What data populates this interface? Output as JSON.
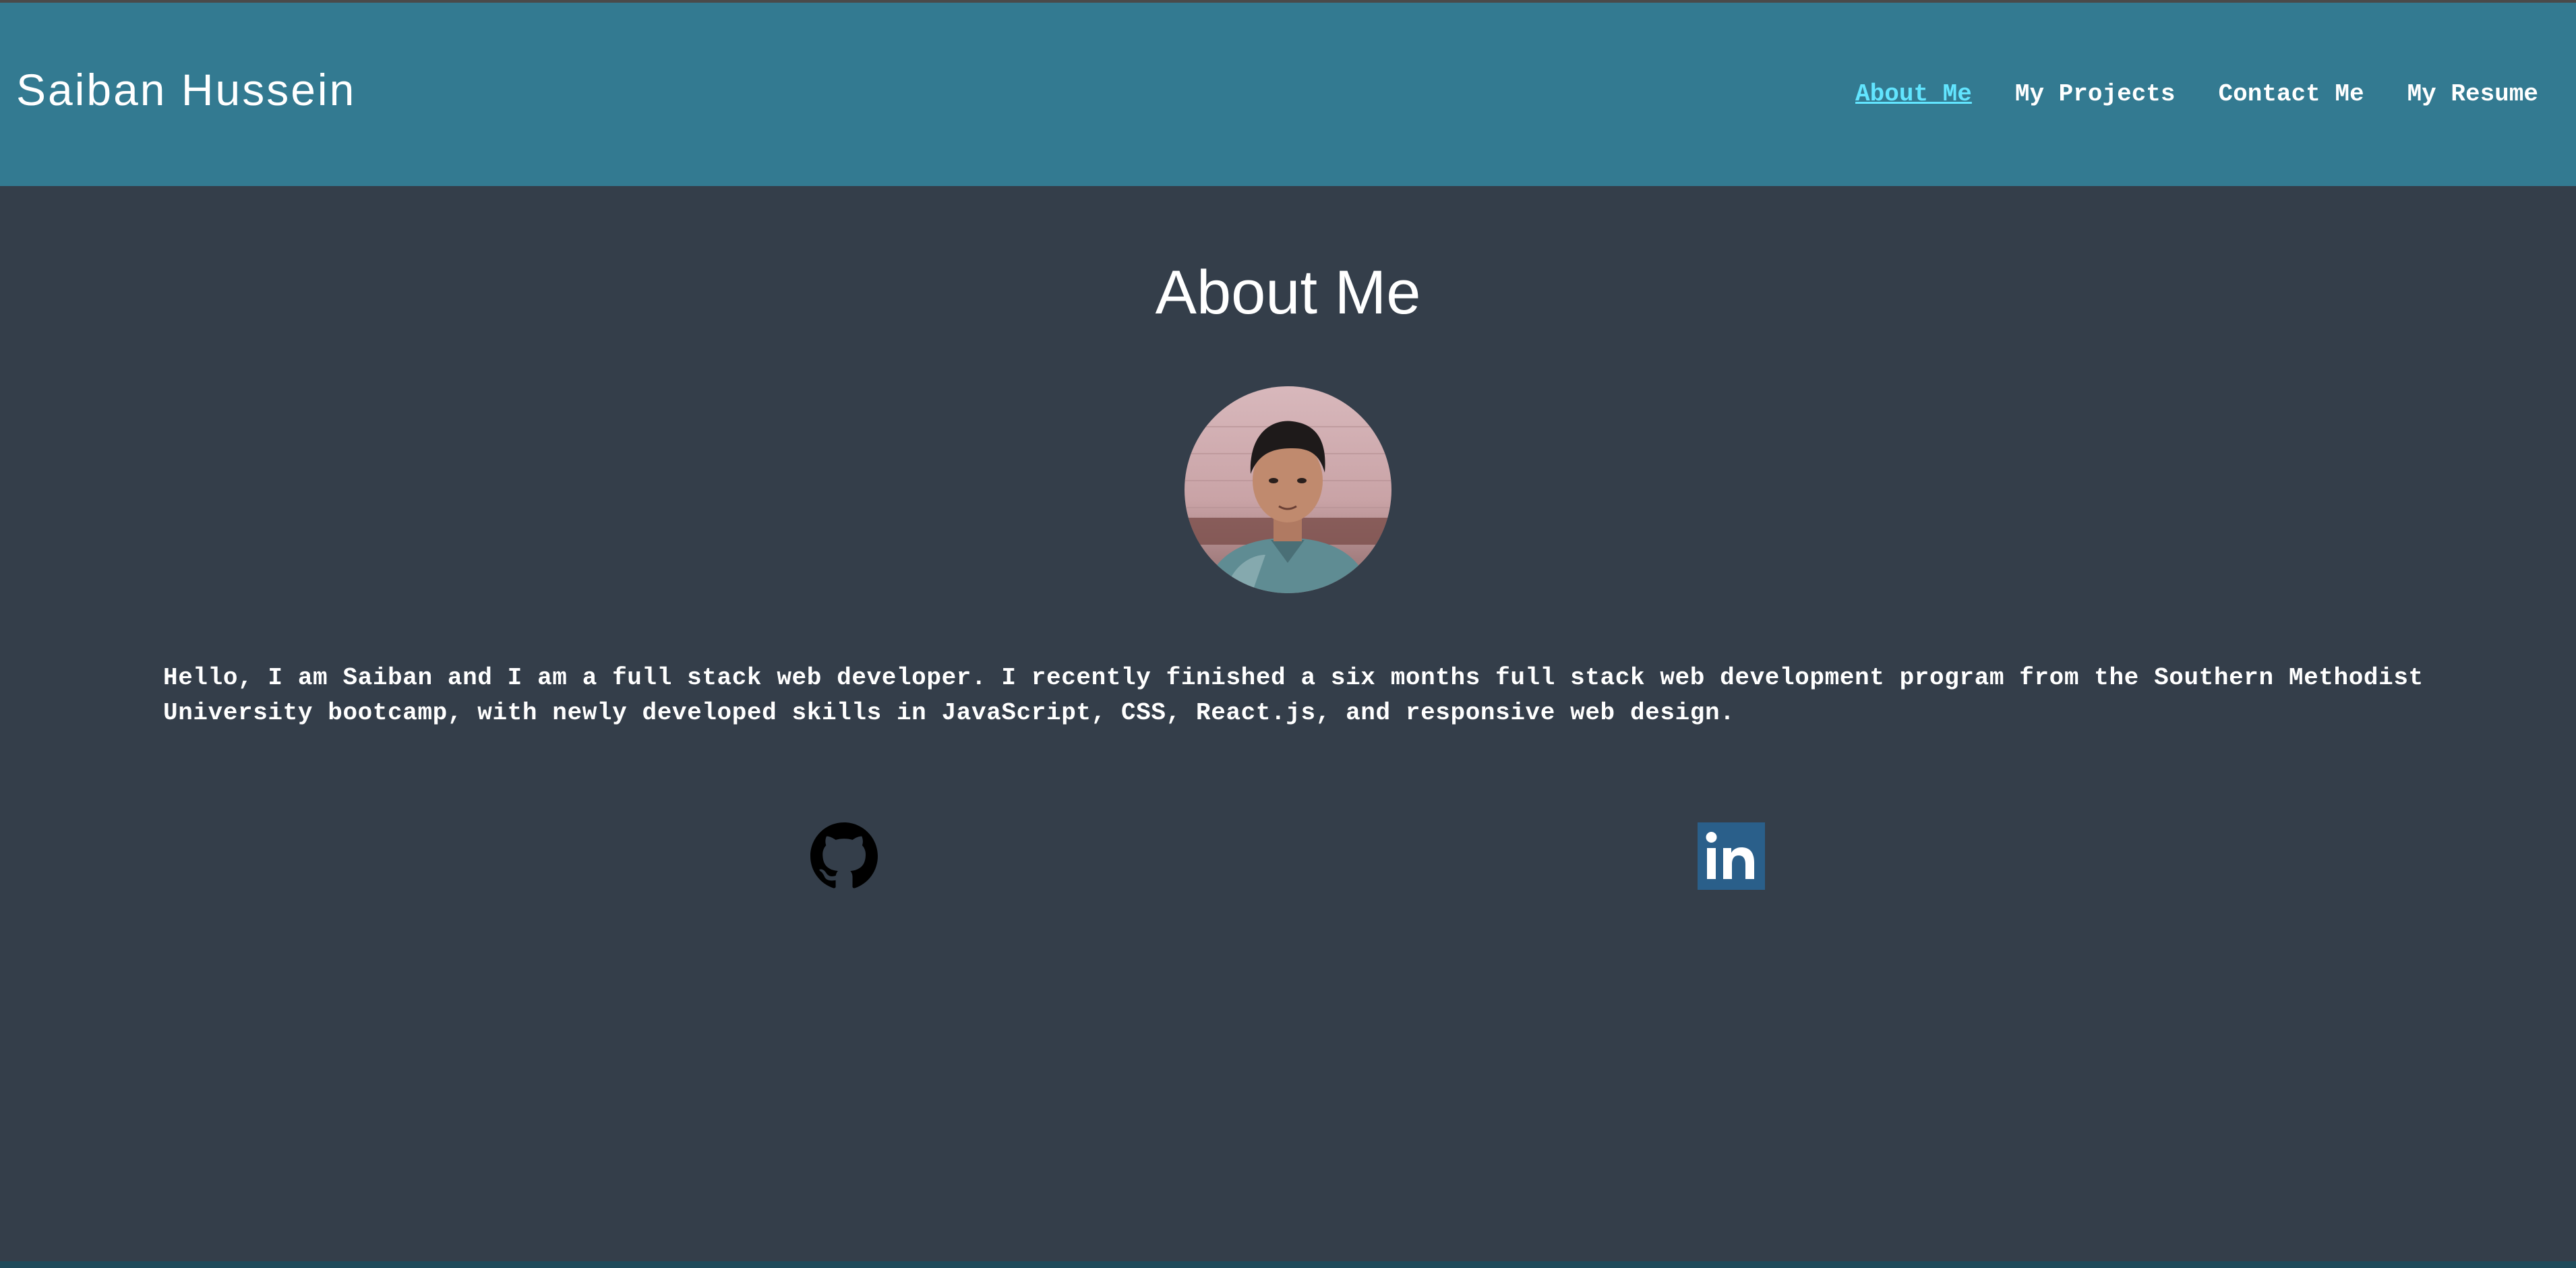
{
  "header": {
    "site_name": "Saiban Hussein",
    "nav": [
      {
        "label": "About Me",
        "active": true
      },
      {
        "label": "My Projects",
        "active": false
      },
      {
        "label": "Contact Me",
        "active": false
      },
      {
        "label": "My Resume",
        "active": false
      }
    ]
  },
  "main": {
    "title": "About Me",
    "bio": "Hello, I am Saiban and I am a full stack web developer. I recently finished a six months full stack web development program from the Southern Methodist University bootcamp, with newly developed skills in JavaScript, CSS, React.js, and responsive web design.",
    "social": [
      {
        "icon": "github-icon"
      },
      {
        "icon": "linkedin-icon"
      }
    ]
  },
  "colors": {
    "header_bg": "#337a91",
    "page_bg": "#343e4a",
    "active_link": "#62e5ff",
    "text": "#ffffff",
    "linkedin_bg": "#2a5f8a"
  }
}
